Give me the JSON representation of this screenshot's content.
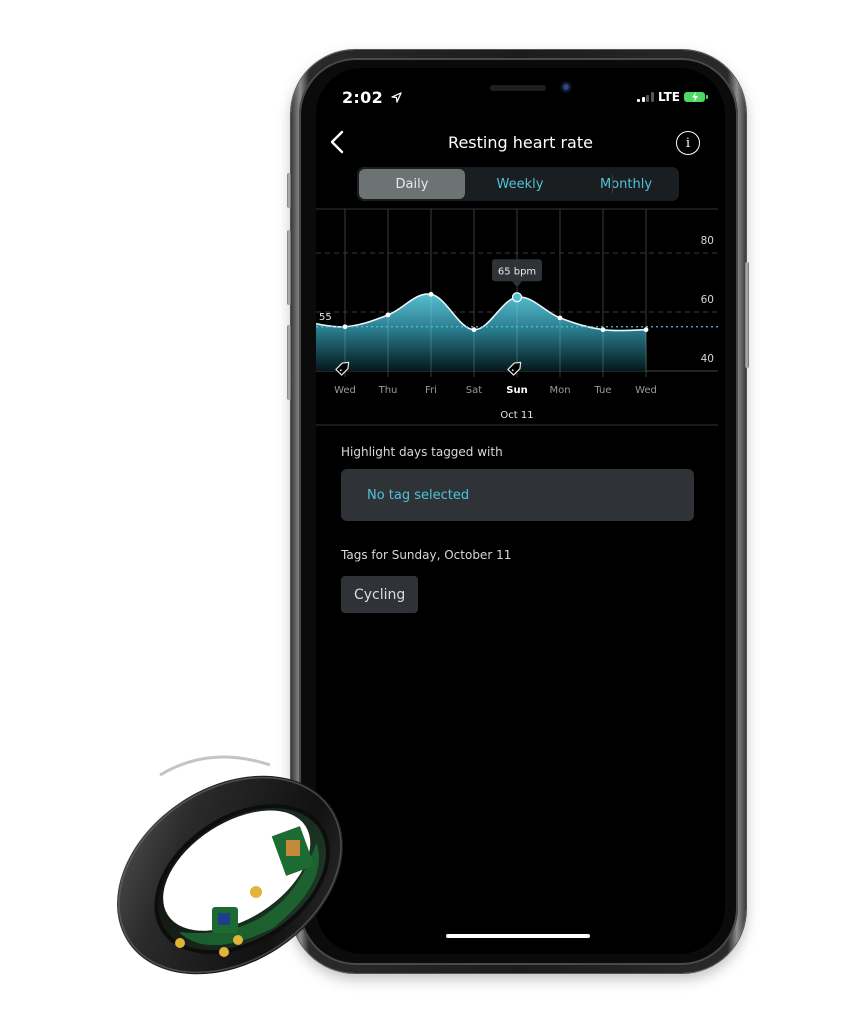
{
  "status_bar": {
    "time": "2:02",
    "location_icon": "location-arrow-icon",
    "network": "LTE",
    "signal_bars_active": 2,
    "signal_bars_total": 4,
    "battery_state": "charging",
    "battery_color": "#4cd964"
  },
  "nav": {
    "back_icon": "chevron-left-icon",
    "title": "Resting heart rate",
    "info_icon": "info-icon",
    "info_glyph": "i"
  },
  "segments": [
    {
      "label": "Daily",
      "active": true
    },
    {
      "label": "Weekly",
      "active": false
    },
    {
      "label": "Monthly",
      "active": false
    }
  ],
  "colors": {
    "accent": "#4fc2d8",
    "segment_active_bg": "#6d7373",
    "card_bg": "#2f3337",
    "chart_fill_top": "#5cc8dc",
    "chart_fill_bottom": "#000000"
  },
  "chart_data": {
    "type": "area",
    "title": "Resting heart rate",
    "categories": [
      "Wed",
      "Thu",
      "Fri",
      "Sat",
      "Sun",
      "Mon",
      "Tue",
      "Wed"
    ],
    "series": [
      {
        "name": "Resting heart rate (bpm)",
        "values": [
          55,
          59,
          66,
          54,
          65,
          58,
          54,
          54
        ]
      }
    ],
    "previous_value_offscreen": 57,
    "average_line": {
      "value": 55,
      "label": "55"
    },
    "yticks": [
      40,
      60,
      80
    ],
    "ytick_labels": [
      "40",
      "60",
      "80"
    ],
    "ylim": [
      40,
      80
    ],
    "selected": {
      "index": 4,
      "tooltip": "65 bpm",
      "date_label": "Oct 11"
    },
    "tagged_indices": [
      0,
      4
    ],
    "tag_icon": "tag-icon",
    "grid": true,
    "xlabel": "",
    "ylabel": ""
  },
  "highlight": {
    "label": "Highlight days tagged with",
    "select_value": "No tag selected"
  },
  "tags_for_day": {
    "label": "Tags for Sunday, October 11",
    "tags": [
      "Cycling"
    ]
  }
}
